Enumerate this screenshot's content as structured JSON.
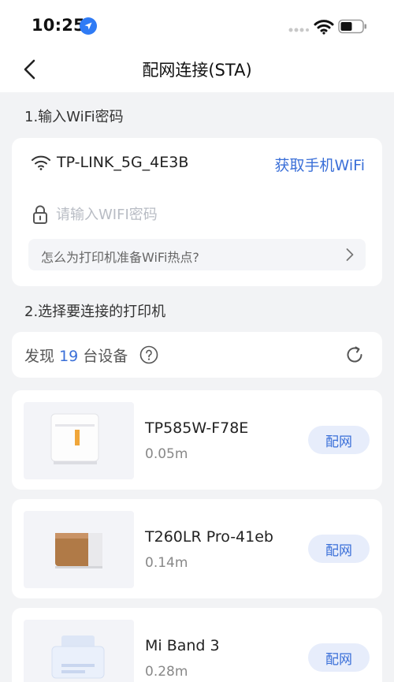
{
  "status_bar": {
    "time": "10:25",
    "icons": [
      "location-arrow-icon",
      "cellular-signal-icon",
      "wifi-icon",
      "battery-icon"
    ]
  },
  "nav": {
    "back_icon": "chevron-left-icon",
    "title": "配网连接(STA)"
  },
  "section1": {
    "label": "1.输入WiFi密码",
    "ssid": "TP-LINK_5G_4E3B",
    "get_wifi_label": "获取手机WiFi",
    "password_placeholder": "请输入WIFI密码",
    "help_text": "怎么为打印机准备WiFi热点?"
  },
  "section2": {
    "label": "2.选择要连接的打印机",
    "found_prefix": "发现",
    "found_count": "19",
    "found_suffix": "台设备"
  },
  "devices": [
    {
      "name": "TP585W-F78E",
      "distance": "0.05m",
      "button": "配网"
    },
    {
      "name": "T260LR Pro-41eb",
      "distance": "0.14m",
      "button": "配网"
    },
    {
      "name": "Mi Band 3",
      "distance": "0.28m",
      "button": "配网"
    }
  ],
  "colors": {
    "accent": "#3a6fd8",
    "button_bg": "#e7edfb",
    "page_bg": "#f2f3f5",
    "location_icon": "#2f7bf5"
  }
}
